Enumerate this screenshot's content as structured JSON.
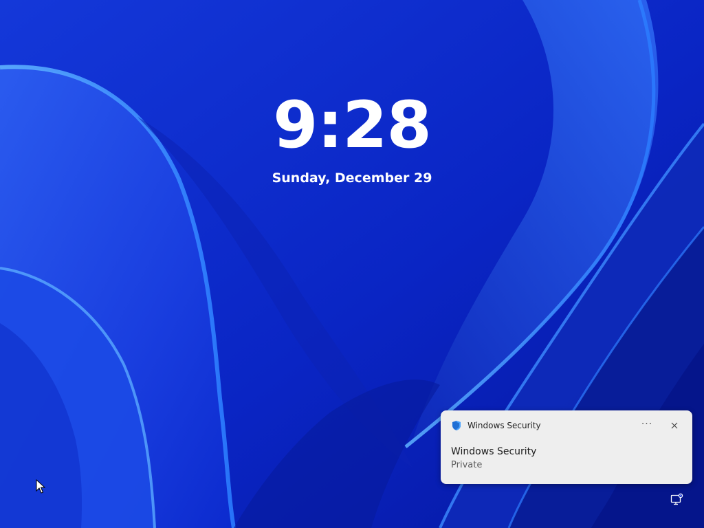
{
  "lockscreen": {
    "time": "9:28",
    "date": "Sunday, December 29"
  },
  "notification": {
    "app_name": "Windows Security",
    "app_icon": "shield-icon",
    "more_icon": "more-options-icon",
    "more_label": "···",
    "close_icon": "close-icon",
    "title": "Windows Security",
    "body": "Private"
  },
  "system_tray": {
    "network_icon": "network-status-icon"
  },
  "colors": {
    "wallpaper_base": "#0b2bd0",
    "wallpaper_dark": "#061a8c",
    "wallpaper_light": "#3d8cff",
    "toast_background": "#eeeeee",
    "text_white": "#ffffff"
  }
}
